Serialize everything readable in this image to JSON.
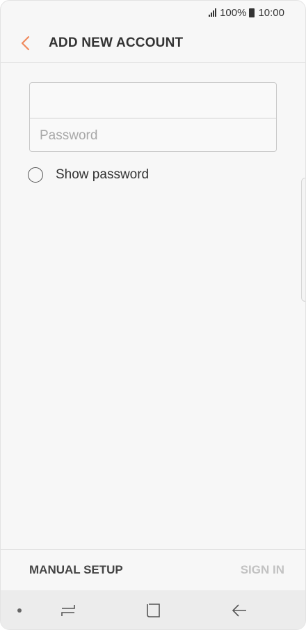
{
  "status_bar": {
    "battery": "100%",
    "time": "10:00"
  },
  "header": {
    "title": "ADD NEW ACCOUNT",
    "back_icon": "chevron-left-icon",
    "accent_color": "#f08a5d"
  },
  "form": {
    "email_value": "",
    "email_placeholder": "",
    "password_placeholder": "Password",
    "show_password_label": "Show password",
    "show_password_checked": false
  },
  "actions": {
    "manual_setup_label": "MANUAL SETUP",
    "sign_in_label": "SIGN IN"
  },
  "nav_bar": {
    "recent_icon": "recent-apps-icon",
    "home_icon": "home-icon",
    "back_icon": "back-arrow-icon"
  }
}
